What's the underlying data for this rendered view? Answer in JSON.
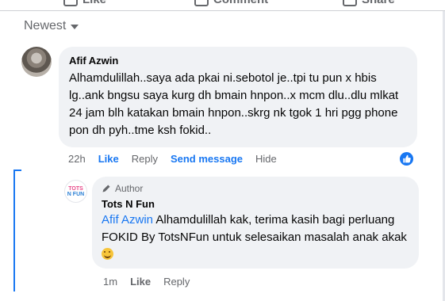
{
  "top_actions": {
    "like": "Like",
    "comment": "Comment",
    "share": "Share"
  },
  "sort": {
    "label": "Newest"
  },
  "comment": {
    "author": "Afif Azwin",
    "text": "Alhamdulillah..saya ada pkai ni.sebotol je..tpi tu pun x hbis lg..ank bngsu saya kurg dh bmain hnpon..x mcm dlu..dlu mlkat 24 jam blh katakan bmain hnpon..skrg nk tgok 1 hri pgg phone pon dh pyh..tme ksh fokid..",
    "time": "22h",
    "like": "Like",
    "reply": "Reply",
    "send_message": "Send message",
    "hide": "Hide",
    "reaction_icon": "thumbs-up-icon"
  },
  "reply": {
    "badge": "Author",
    "author": "Tots N Fun",
    "avatar_line1": "TOTS",
    "avatar_line2": "N FUN",
    "mention": "Afif Azwin",
    "text": " Alhamdulillah kak, terima kasih bagi perluang FOKID By TotsNFun untuk selesaikan masalah anak akak",
    "time": "1m",
    "like": "Like",
    "reply": "Reply"
  },
  "colors": {
    "accent": "#1877f2",
    "muted": "#65676b",
    "bubble": "#f0f2f5"
  }
}
